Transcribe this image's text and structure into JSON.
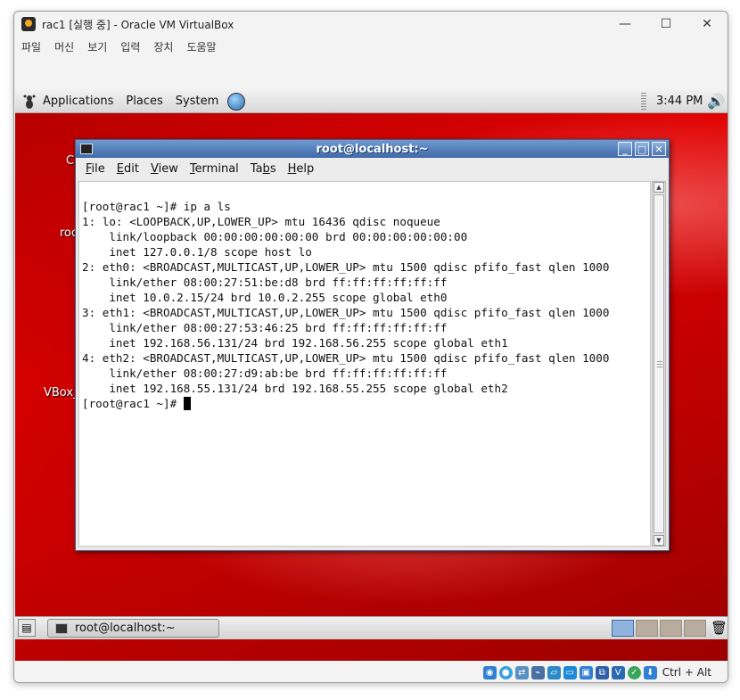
{
  "host_window": {
    "title": "rac1 [실행 중] - Oracle VM VirtualBox",
    "controls": {
      "minimize": "—",
      "maximize": "☐",
      "close": "✕"
    },
    "menu": [
      "파일",
      "머신",
      "보기",
      "입력",
      "장치",
      "도움말"
    ]
  },
  "guest": {
    "top_panel": {
      "menus": [
        "Applications",
        "Places",
        "System"
      ],
      "clock": "3:44 PM"
    },
    "desktop_labels": [
      "C",
      "roo",
      "VBox_"
    ],
    "terminal": {
      "title": "root@localhost:~",
      "menu": [
        {
          "mnemonic": "F",
          "rest": "ile"
        },
        {
          "mnemonic": "E",
          "rest": "dit"
        },
        {
          "mnemonic": "V",
          "rest": "iew"
        },
        {
          "mnemonic": "T",
          "rest": "erminal"
        },
        {
          "pre": "Ta",
          "mnemonic": "b",
          "rest": "s"
        },
        {
          "mnemonic": "H",
          "rest": "elp"
        }
      ],
      "lines": [
        "[root@rac1 ~]# ip a ls",
        "1: lo: <LOOPBACK,UP,LOWER_UP> mtu 16436 qdisc noqueue",
        "    link/loopback 00:00:00:00:00:00 brd 00:00:00:00:00:00",
        "    inet 127.0.0.1/8 scope host lo",
        "2: eth0: <BROADCAST,MULTICAST,UP,LOWER_UP> mtu 1500 qdisc pfifo_fast qlen 1000",
        "    link/ether 08:00:27:51:be:d8 brd ff:ff:ff:ff:ff:ff",
        "    inet 10.0.2.15/24 brd 10.0.2.255 scope global eth0",
        "3: eth1: <BROADCAST,MULTICAST,UP,LOWER_UP> mtu 1500 qdisc pfifo_fast qlen 1000",
        "    link/ether 08:00:27:53:46:25 brd ff:ff:ff:ff:ff:ff",
        "    inet 192.168.56.131/24 brd 192.168.56.255 scope global eth1",
        "4: eth2: <BROADCAST,MULTICAST,UP,LOWER_UP> mtu 1500 qdisc pfifo_fast qlen 1000",
        "    link/ether 08:00:27:d9:ab:be brd ff:ff:ff:ff:ff:ff",
        "    inet 192.168.55.131/24 brd 192.168.55.255 scope global eth2"
      ],
      "prompt": "[root@rac1 ~]# "
    },
    "bottom_panel": {
      "task_label": "root@localhost:~",
      "workspace_count": 4,
      "active_workspace": 1
    }
  },
  "statusbar": {
    "icons": [
      "optical-disk-icon",
      "audio-icon",
      "network-icon",
      "usb-icon",
      "shared-folder-icon",
      "display-icon",
      "video-capture-icon",
      "virtualization-icon",
      "mouse-integration-icon",
      "keyboard-capture-icon"
    ],
    "host_key": "Ctrl + Alt"
  },
  "colors": {
    "desktop_red": "#d00000",
    "terminal_title": "#4f79b6",
    "active_workspace": "#8fb3de"
  }
}
